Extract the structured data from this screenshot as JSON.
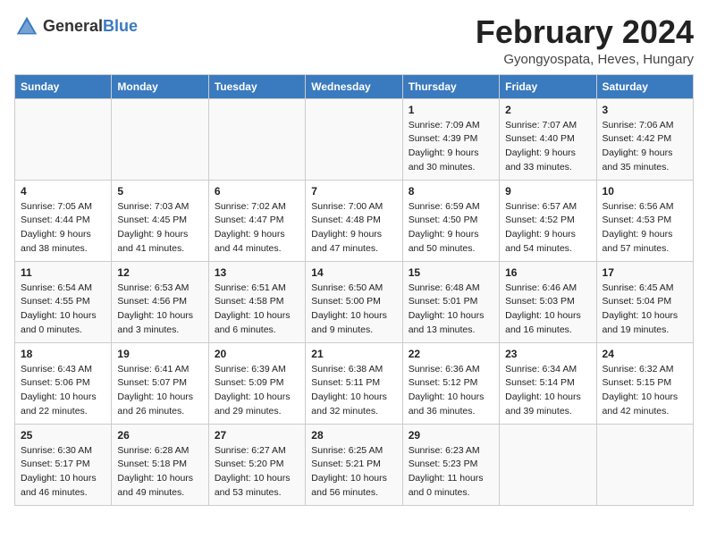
{
  "header": {
    "logo_general": "General",
    "logo_blue": "Blue",
    "month_title": "February 2024",
    "location": "Gyongyospata, Heves, Hungary"
  },
  "calendar": {
    "days_of_week": [
      "Sunday",
      "Monday",
      "Tuesday",
      "Wednesday",
      "Thursday",
      "Friday",
      "Saturday"
    ],
    "weeks": [
      [
        {
          "day": "",
          "details": ""
        },
        {
          "day": "",
          "details": ""
        },
        {
          "day": "",
          "details": ""
        },
        {
          "day": "",
          "details": ""
        },
        {
          "day": "1",
          "details": "Sunrise: 7:09 AM\nSunset: 4:39 PM\nDaylight: 9 hours\nand 30 minutes."
        },
        {
          "day": "2",
          "details": "Sunrise: 7:07 AM\nSunset: 4:40 PM\nDaylight: 9 hours\nand 33 minutes."
        },
        {
          "day": "3",
          "details": "Sunrise: 7:06 AM\nSunset: 4:42 PM\nDaylight: 9 hours\nand 35 minutes."
        }
      ],
      [
        {
          "day": "4",
          "details": "Sunrise: 7:05 AM\nSunset: 4:44 PM\nDaylight: 9 hours\nand 38 minutes."
        },
        {
          "day": "5",
          "details": "Sunrise: 7:03 AM\nSunset: 4:45 PM\nDaylight: 9 hours\nand 41 minutes."
        },
        {
          "day": "6",
          "details": "Sunrise: 7:02 AM\nSunset: 4:47 PM\nDaylight: 9 hours\nand 44 minutes."
        },
        {
          "day": "7",
          "details": "Sunrise: 7:00 AM\nSunset: 4:48 PM\nDaylight: 9 hours\nand 47 minutes."
        },
        {
          "day": "8",
          "details": "Sunrise: 6:59 AM\nSunset: 4:50 PM\nDaylight: 9 hours\nand 50 minutes."
        },
        {
          "day": "9",
          "details": "Sunrise: 6:57 AM\nSunset: 4:52 PM\nDaylight: 9 hours\nand 54 minutes."
        },
        {
          "day": "10",
          "details": "Sunrise: 6:56 AM\nSunset: 4:53 PM\nDaylight: 9 hours\nand 57 minutes."
        }
      ],
      [
        {
          "day": "11",
          "details": "Sunrise: 6:54 AM\nSunset: 4:55 PM\nDaylight: 10 hours\nand 0 minutes."
        },
        {
          "day": "12",
          "details": "Sunrise: 6:53 AM\nSunset: 4:56 PM\nDaylight: 10 hours\nand 3 minutes."
        },
        {
          "day": "13",
          "details": "Sunrise: 6:51 AM\nSunset: 4:58 PM\nDaylight: 10 hours\nand 6 minutes."
        },
        {
          "day": "14",
          "details": "Sunrise: 6:50 AM\nSunset: 5:00 PM\nDaylight: 10 hours\nand 9 minutes."
        },
        {
          "day": "15",
          "details": "Sunrise: 6:48 AM\nSunset: 5:01 PM\nDaylight: 10 hours\nand 13 minutes."
        },
        {
          "day": "16",
          "details": "Sunrise: 6:46 AM\nSunset: 5:03 PM\nDaylight: 10 hours\nand 16 minutes."
        },
        {
          "day": "17",
          "details": "Sunrise: 6:45 AM\nSunset: 5:04 PM\nDaylight: 10 hours\nand 19 minutes."
        }
      ],
      [
        {
          "day": "18",
          "details": "Sunrise: 6:43 AM\nSunset: 5:06 PM\nDaylight: 10 hours\nand 22 minutes."
        },
        {
          "day": "19",
          "details": "Sunrise: 6:41 AM\nSunset: 5:07 PM\nDaylight: 10 hours\nand 26 minutes."
        },
        {
          "day": "20",
          "details": "Sunrise: 6:39 AM\nSunset: 5:09 PM\nDaylight: 10 hours\nand 29 minutes."
        },
        {
          "day": "21",
          "details": "Sunrise: 6:38 AM\nSunset: 5:11 PM\nDaylight: 10 hours\nand 32 minutes."
        },
        {
          "day": "22",
          "details": "Sunrise: 6:36 AM\nSunset: 5:12 PM\nDaylight: 10 hours\nand 36 minutes."
        },
        {
          "day": "23",
          "details": "Sunrise: 6:34 AM\nSunset: 5:14 PM\nDaylight: 10 hours\nand 39 minutes."
        },
        {
          "day": "24",
          "details": "Sunrise: 6:32 AM\nSunset: 5:15 PM\nDaylight: 10 hours\nand 42 minutes."
        }
      ],
      [
        {
          "day": "25",
          "details": "Sunrise: 6:30 AM\nSunset: 5:17 PM\nDaylight: 10 hours\nand 46 minutes."
        },
        {
          "day": "26",
          "details": "Sunrise: 6:28 AM\nSunset: 5:18 PM\nDaylight: 10 hours\nand 49 minutes."
        },
        {
          "day": "27",
          "details": "Sunrise: 6:27 AM\nSunset: 5:20 PM\nDaylight: 10 hours\nand 53 minutes."
        },
        {
          "day": "28",
          "details": "Sunrise: 6:25 AM\nSunset: 5:21 PM\nDaylight: 10 hours\nand 56 minutes."
        },
        {
          "day": "29",
          "details": "Sunrise: 6:23 AM\nSunset: 5:23 PM\nDaylight: 11 hours\nand 0 minutes."
        },
        {
          "day": "",
          "details": ""
        },
        {
          "day": "",
          "details": ""
        }
      ]
    ]
  }
}
